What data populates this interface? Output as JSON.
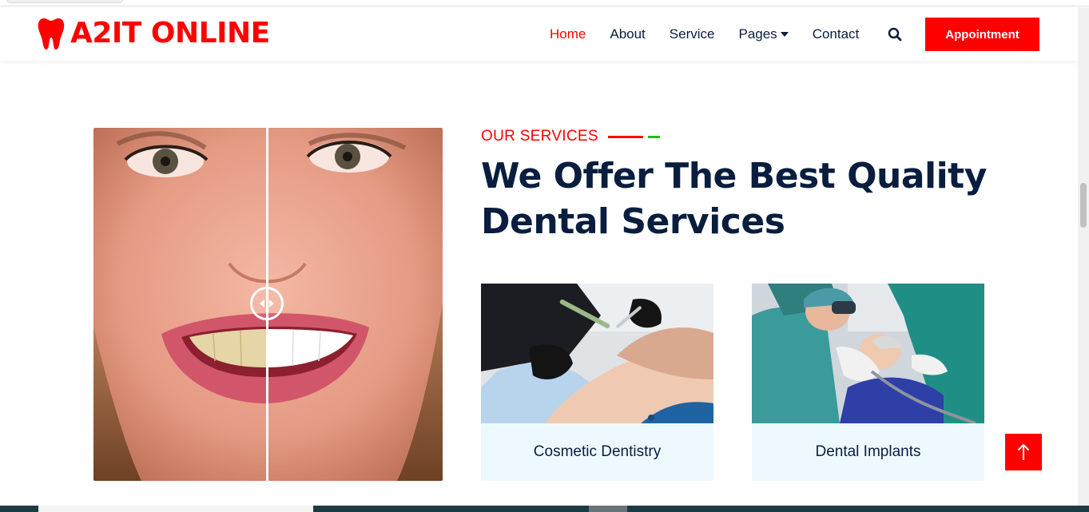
{
  "header": {
    "brand": "A2IT ONLINE",
    "nav": [
      {
        "label": "Home",
        "active": true
      },
      {
        "label": "About",
        "active": false
      },
      {
        "label": "Service",
        "active": false
      },
      {
        "label": "Pages",
        "active": false,
        "dropdown": true
      },
      {
        "label": "Contact",
        "active": false
      }
    ],
    "search_icon": "search-icon",
    "appointment_label": "Appointment"
  },
  "services": {
    "eyebrow": "OUR SERVICES",
    "title": "We Offer The Best Quality Dental Services",
    "cards": [
      {
        "label": "Cosmetic Dentistry",
        "image": "dentist-treating-patient-photo"
      },
      {
        "label": "Dental Implants",
        "image": "dental-implant-surgery-photo"
      }
    ]
  },
  "comparison": {
    "image": "before-after-teeth-whitening-photo"
  },
  "colors": {
    "accent": "#ff0000",
    "heading": "#091e3e",
    "green": "#13c113",
    "card_bg": "#eef9ff"
  }
}
